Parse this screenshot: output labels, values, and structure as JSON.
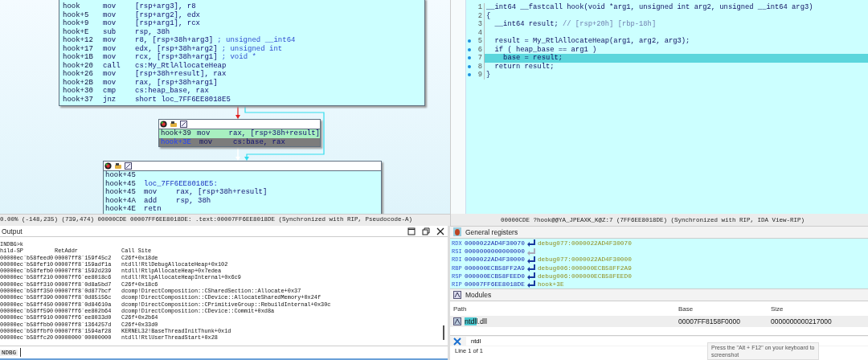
{
  "graph_view": {
    "blocks": [
      {
        "kind": "top",
        "lines": [
          {
            "addr": "hook",
            "mnemonic": "mov",
            "operand": "[rsp+arg3], r8"
          },
          {
            "addr": "hook+5",
            "mnemonic": "mov",
            "operand": "[rsp+arg2], edx"
          },
          {
            "addr": "hook+9",
            "mnemonic": "mov",
            "operand": "[rsp+arg1], rcx"
          },
          {
            "addr": "hook+E",
            "mnemonic": "sub",
            "operand": "rsp, 38h"
          },
          {
            "addr": "hook+12",
            "mnemonic": "mov",
            "operand": "r8, [rsp+38h+arg3]",
            "comment": "; unsigned __int64"
          },
          {
            "addr": "hook+17",
            "mnemonic": "mov",
            "operand": "edx, [rsp+38h+arg2]",
            "comment": "; unsigned int"
          },
          {
            "addr": "hook+1B",
            "mnemonic": "mov",
            "operand": "rcx, [rsp+38h+arg1]",
            "comment": "; void *"
          },
          {
            "addr": "hook+20",
            "mnemonic": "call",
            "operand": "cs:My_RtlAllocateHeap"
          },
          {
            "addr": "hook+26",
            "mnemonic": "mov",
            "operand": "[rsp+38h+result], rax"
          },
          {
            "addr": "hook+2B",
            "mnemonic": "mov",
            "operand": "rax, [rsp+38h+arg1]"
          },
          {
            "addr": "hook+30",
            "mnemonic": "cmp",
            "operand": "cs:heap_base, rax"
          },
          {
            "addr": "hook+37",
            "mnemonic": "jnz",
            "operand": "short loc_7FF6EE8018E5"
          }
        ]
      },
      {
        "kind": "branch",
        "lines": [
          {
            "addr": "hook+39",
            "mnemonic": "mov",
            "operand": "rax, [rsp+38h+result]",
            "executed": true,
            "selected": false
          },
          {
            "addr": "hook+3E",
            "mnemonic": "mov",
            "operand": "cs:base, rax",
            "executed": false,
            "selected": true
          }
        ]
      },
      {
        "kind": "join",
        "lines": [
          {
            "addr": "hook+45"
          },
          {
            "addr": "hook+45",
            "label": "loc_7FF6EE8018E5:"
          },
          {
            "addr": "hook+45",
            "mnemonic": "mov",
            "operand": "rax, [rsp+38h+result]"
          },
          {
            "addr": "hook+4A",
            "mnemonic": "add",
            "operand": "rsp, 38h"
          },
          {
            "addr": "hook+4E",
            "mnemonic": "retn"
          }
        ]
      }
    ],
    "status_bar": "0.00% (-148,235) (739,474) 00000CDE 00007FF6EE8018DE: .text:00007FF6EE8018DE (Synchronized with RIP, Pseudocode-A)"
  },
  "pseudocode": {
    "lines": [
      {
        "number": "1",
        "text": "__int64 __fastcall hook(void *arg1, unsigned int arg2, unsigned __int64 arg3)",
        "marker": false,
        "selected": false
      },
      {
        "number": "2",
        "text": "{",
        "marker": false,
        "selected": false
      },
      {
        "number": "3",
        "text": "  __int64 result;",
        "comment": "// [rsp+20h] [rbp-18h]",
        "marker": false,
        "selected": false
      },
      {
        "number": "4",
        "marker": false,
        "selected": false
      },
      {
        "number": "5",
        "text": "  result = My_RtlAllocateHeap(arg1, arg2, arg3);",
        "marker": true,
        "selected": false
      },
      {
        "number": "6",
        "text": "  if ( heap_base == arg1 )",
        "marker": true,
        "selected": false
      },
      {
        "number": "7",
        "text": "    base = result;",
        "marker": true,
        "selected": true
      },
      {
        "number": "8",
        "text": "  return result;",
        "marker": true,
        "selected": false
      },
      {
        "number": "9",
        "text": "}",
        "marker": true,
        "selected": false
      }
    ],
    "status_bar": "00000CDE ?hook@@YA_JPEAXK_K@Z:7 (7FF6EE8018DE) (Synchronized with RIP, IDA View-RIP)"
  },
  "output": {
    "title": "Output",
    "history": "INDBG>k",
    "header": {
      "child_sp": "hild-SP",
      "ret_addr": "RetAddr",
      "call_site": "Call Site"
    },
    "frames": [
      {
        "child_sp": "00000ec`b58feed0",
        "ret_addr": "00007ff8`159f45c2",
        "call_site": "C26f+0x18de"
      },
      {
        "child_sp": "00000ec`b58fef10",
        "ret_addr": "00007ff8`159adf1a",
        "call_site": "ntdll!RtlDebugAllocateHeap+0x102"
      },
      {
        "child_sp": "00000ec`b58fefb0",
        "ret_addr": "00007ff8`1592d239",
        "call_site": "ntdll!RtlpAllocateHeap+0x7edea"
      },
      {
        "child_sp": "00000ec`b58ff210",
        "ret_addr": "00007ff6`ee8018c6",
        "call_site": "ntdll!RtlpAllocateHeapInternal+0x6c9"
      },
      {
        "child_sp": "00000ec`b58ff310",
        "ret_addr": "00007ff8`0d8a5bd7",
        "call_site": "C26f+0x18c6"
      },
      {
        "child_sp": "00000ec`b58ff350",
        "ret_addr": "00007ff8`0d877bcf",
        "call_site": "dcomp!DirectComposition::CSharedSection::Allocate+0x37"
      },
      {
        "child_sp": "00000ec`b58ff390",
        "ret_addr": "00007ff8`0d85156c",
        "call_site": "dcomp!DirectComposition::CDevice::AllocateSharedMemory+0x24f"
      },
      {
        "child_sp": "00000ec`b58ff450",
        "ret_addr": "00007ff8`0d84610a",
        "call_site": "dcomp!DirectComposition::CPrimitiveGroup::RebuildInternal+0x30c"
      },
      {
        "child_sp": "00000ec`b58ff590",
        "ret_addr": "00007ff6`ee802b64",
        "call_site": "dcomp!DirectComposition::CDevice::Commit+0xd8a"
      },
      {
        "child_sp": "00000ec`b58ff910",
        "ret_addr": "00007ff6`ee8033d0",
        "call_site": "C26f+0x2b64"
      },
      {
        "child_sp": "00000ec`b58ffbb0",
        "ret_addr": "00007ff8`1364257d",
        "call_site": "C26f+0x33d0"
      },
      {
        "child_sp": "00000ec`b58ffbf0",
        "ret_addr": "00007ff8`1594af28",
        "call_site": "KERNEL32!BaseThreadInitThunk+0x1d"
      },
      {
        "child_sp": "00000ec`b58ffc20",
        "ret_addr": "00000000`00000000",
        "call_site": "ntdll!RtlUserThreadStart+0x28"
      }
    ],
    "prompt": "NDBG"
  },
  "registers": {
    "title": "General registers",
    "rows": [
      {
        "name": "RDX",
        "value": "0000022AD4F30070",
        "target": "debug077:0000022AD4F30070"
      },
      {
        "name": "RSI",
        "value": "0000000000000000"
      },
      {
        "name": "RDI",
        "value": "0000022AD4F30000",
        "target": "debug077:0000022AD4F30000"
      },
      {
        "name": "RBP",
        "value": "000000ECB58FF2A9",
        "target": "debug006:000000ECB58FF2A9"
      },
      {
        "name": "RSP",
        "value": "000000ECB58FEED0",
        "target": "debug006:000000ECB58FEED0"
      },
      {
        "name": "RIP",
        "value": "00007FF6EE8018DE",
        "target": "hook+3E"
      }
    ]
  },
  "modules": {
    "title": "Modules",
    "columns": [
      "Path",
      "Base",
      "Size"
    ],
    "rows": [
      {
        "path_match": "ntdl",
        "path_rest": "l.dll",
        "base": "00007FF8158F0000",
        "size": "0000000000217000"
      }
    ],
    "filter": "ntdl",
    "status": "Line 1 of 1"
  },
  "tooltip": {
    "lines": [
      "Press the \"Alt + F12\" on your keyboard to",
      "screenshot"
    ]
  }
}
